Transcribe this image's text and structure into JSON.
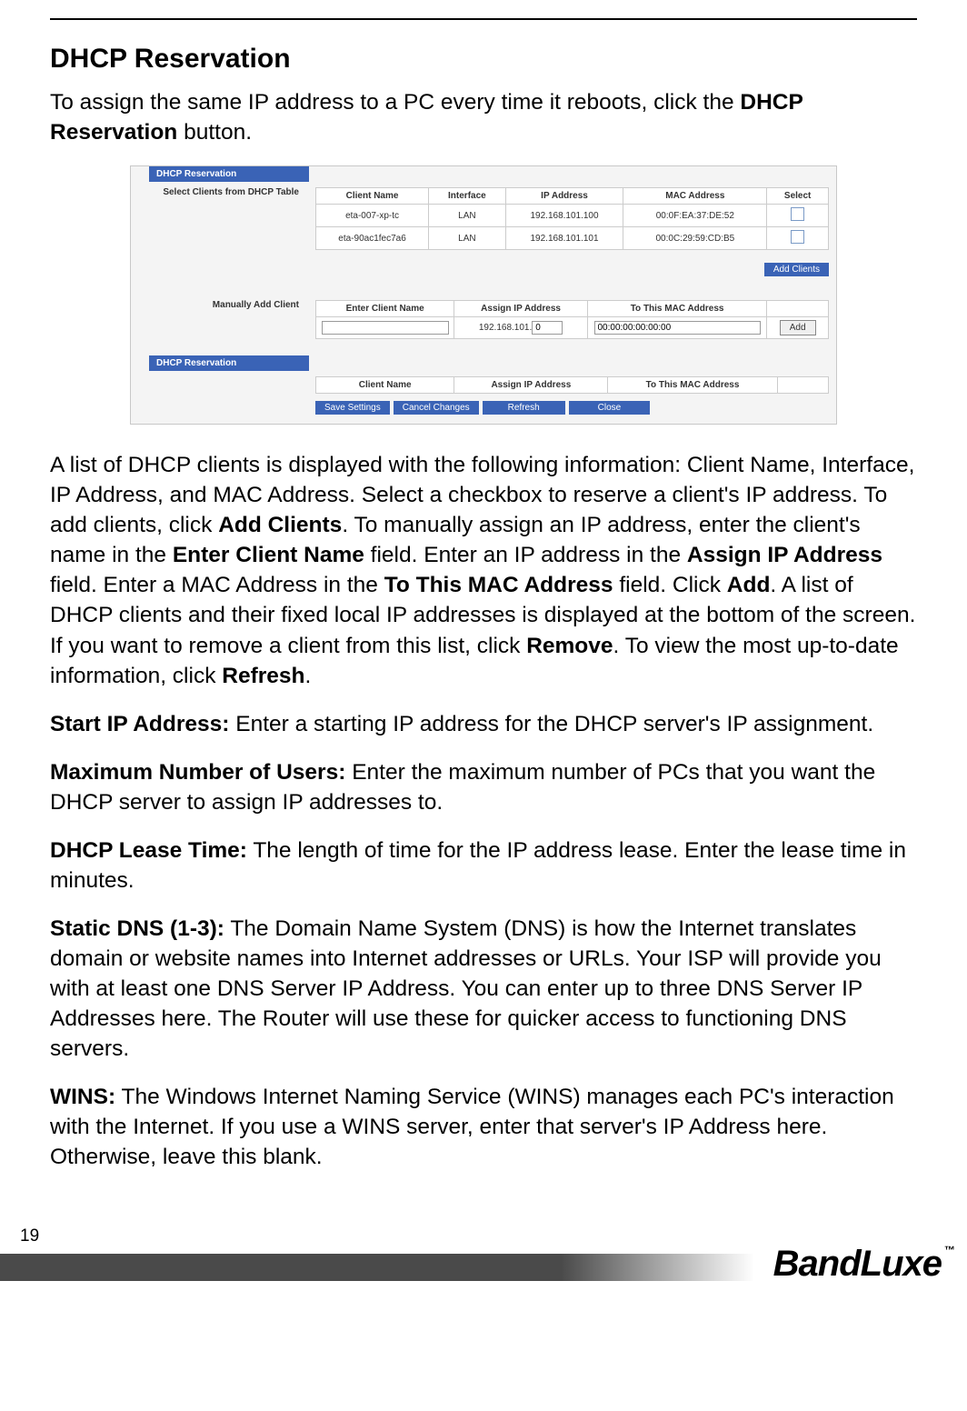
{
  "heading": "DHCP Reservation",
  "intro_a": "To assign the same IP address to a PC every time it reboots, click the ",
  "intro_b": "DHCP Reservation",
  "intro_c": " button.",
  "screenshot": {
    "title": "DHCP Reservation",
    "section1_label": "Select Clients from DHCP Table",
    "th": {
      "name": "Client Name",
      "iface": "Interface",
      "ip": "IP Address",
      "mac": "MAC Address",
      "sel": "Select"
    },
    "rows": [
      {
        "name": "eta-007-xp-tc",
        "iface": "LAN",
        "ip": "192.168.101.100",
        "mac": "00:0F:EA:37:DE:52"
      },
      {
        "name": "eta-90ac1fec7a6",
        "iface": "LAN",
        "ip": "192.168.101.101",
        "mac": "00:0C:29:59:CD:B5"
      }
    ],
    "add_clients_btn": "Add Clients",
    "section2_label": "Manually Add Client",
    "manual_th": {
      "name": "Enter Client Name",
      "ip": "Assign IP Address",
      "mac": "To This MAC Address"
    },
    "ip_prefix": "192.168.101.",
    "ip_last": "0",
    "mac_default": "00:00:00:00:00:00",
    "add_btn": "Add",
    "section3_title": "DHCP Reservation",
    "list_th": {
      "name": "Client Name",
      "ip": "Assign IP Address",
      "mac": "To This MAC Address"
    },
    "toolbar": {
      "save": "Save Settings",
      "cancel": "Cancel Changes",
      "refresh": "Refresh",
      "close": "Close"
    }
  },
  "para1_a": "A list of DHCP clients is displayed with the following information: Client Name, Interface, IP Address, and MAC Address. Select a checkbox to reserve a client's IP address. To add clients, click ",
  "para1_b": "Add Clients",
  "para1_c": ". To manually assign an IP address, enter the client's name in the ",
  "para1_d": "Enter Client Name",
  "para1_e": " field. Enter an IP address in the ",
  "para1_f": "Assign IP Address",
  "para1_g": " field. Enter a MAC Address in the ",
  "para1_h": "To This MAC Address",
  "para1_i": " field. Click ",
  "para1_j": "Add",
  "para1_k": ". A list of DHCP clients and their fixed local IP addresses is displayed at the bottom of the screen. If you want to remove a client from this list, click ",
  "para1_l": "Remove",
  "para1_m": ". To view the most up-to-date information, click ",
  "para1_n": "Refresh",
  "para1_o": ".",
  "p2_label": "Start IP Address:",
  "p2_text": " Enter a starting IP address for the DHCP server's IP assignment.",
  "p3_label": "Maximum Number of Users:",
  "p3_text": " Enter the maximum number of PCs that you want the DHCP server to assign IP addresses to.",
  "p4_label": "DHCP Lease Time:",
  "p4_text": " The length of time for the IP address lease. Enter the lease time in minutes.",
  "p5_label": "Static DNS (1-3):",
  "p5_text": " The Domain Name System (DNS) is how the Internet translates domain or website names into Internet addresses or URLs. Your ISP will provide you with at least one DNS Server IP Address. You can enter up to three DNS Server IP Addresses here. The Router will use these for quicker access to functioning DNS servers.",
  "p6_label": "WINS:",
  "p6_text": " The Windows Internet Naming Service (WINS) manages each PC's interaction with the Internet. If you use a WINS server, enter that server's IP Address here. Otherwise, leave this blank.",
  "page_number": "19",
  "logo_text": "BandLuxe",
  "logo_tm": "™"
}
